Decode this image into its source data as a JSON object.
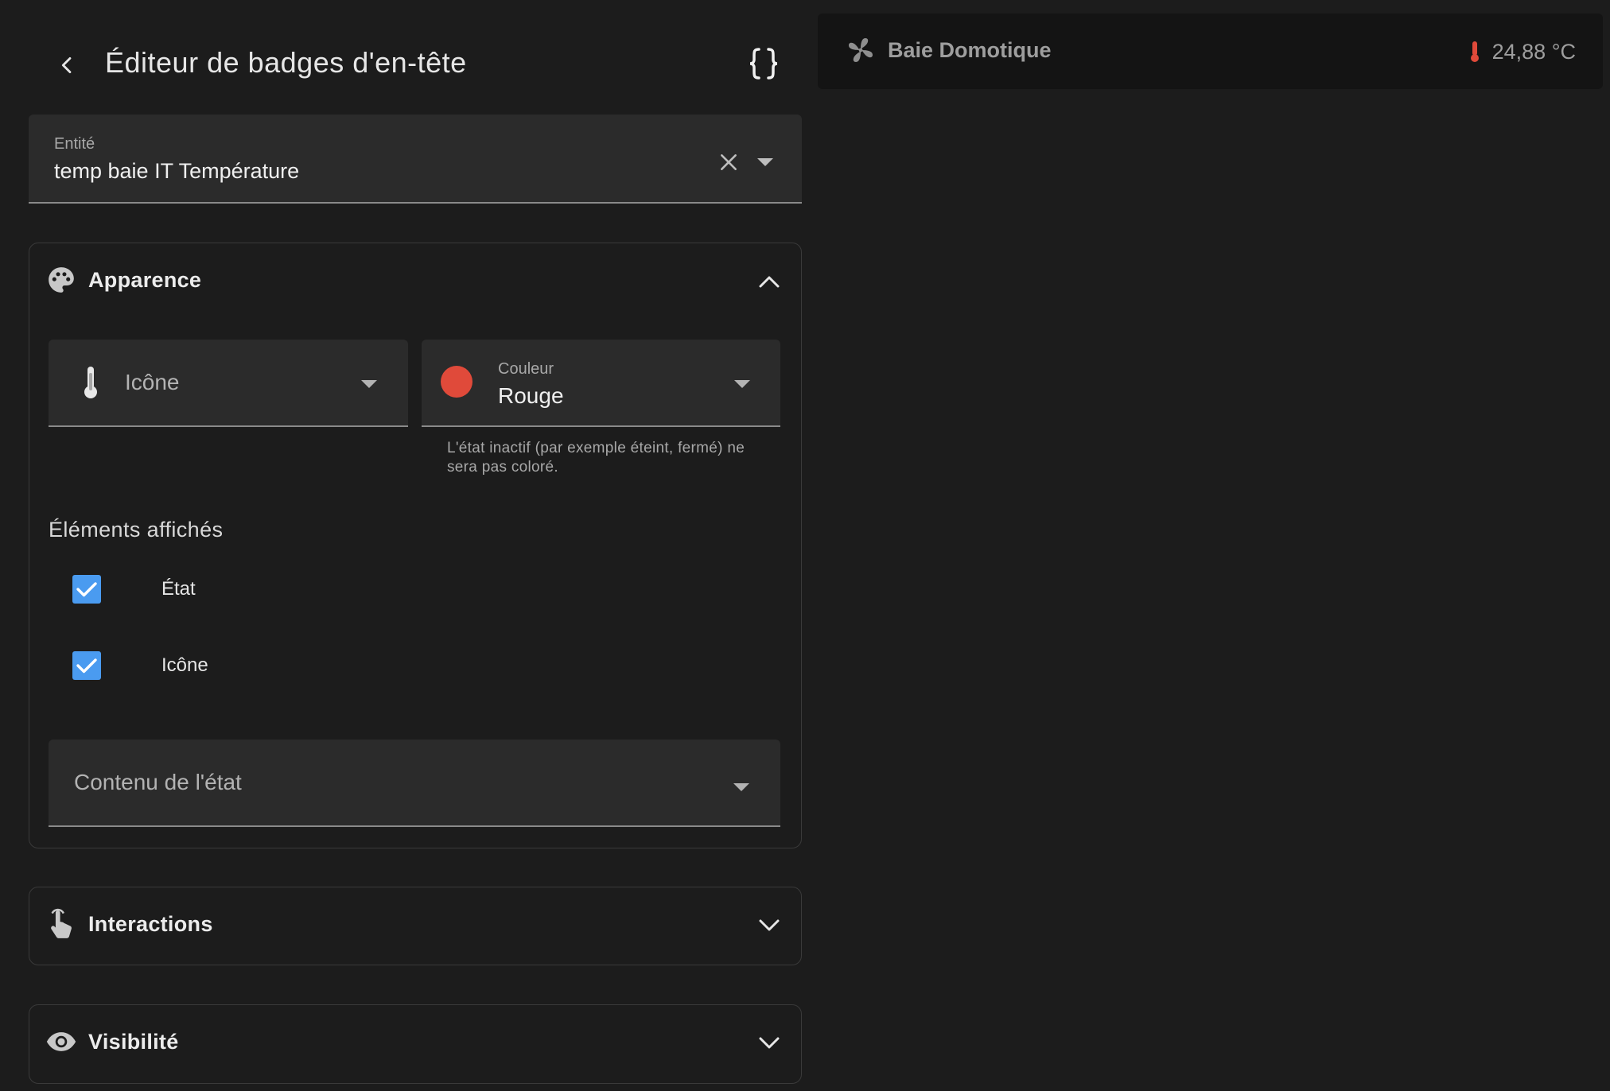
{
  "header": {
    "title": "Éditeur de badges d'en-tête",
    "back_icon": "arrow-left-icon",
    "code_icon": "code-braces-icon"
  },
  "entity": {
    "label": "Entité",
    "value": "temp baie IT Température"
  },
  "appearance": {
    "title": "Apparence",
    "icon_field": {
      "placeholder": "Icône",
      "icon": "thermometer-icon"
    },
    "color_field": {
      "label": "Couleur",
      "value": "Rouge",
      "swatch": "#e04a3a",
      "helper": "L'état inactif (par exemple éteint, fermé) ne sera pas coloré."
    },
    "displayed_elements": {
      "label": "Éléments affichés",
      "items": [
        {
          "label": "État",
          "checked": true
        },
        {
          "label": "Icône",
          "checked": true
        }
      ]
    },
    "state_content": {
      "placeholder": "Contenu de l'état"
    }
  },
  "interactions": {
    "title": "Interactions"
  },
  "visibility": {
    "title": "Visibilité"
  },
  "preview": {
    "title": "Baie Domotique",
    "value": "24,88 °C",
    "icon": "fan-icon",
    "badge_icon": "thermometer-icon",
    "badge_color": "#e04a3a"
  },
  "colors": {
    "background": "#1c1c1c",
    "field": "#2b2b2b",
    "checkbox": "#4a9bf0",
    "accent_red": "#e04a3a"
  }
}
